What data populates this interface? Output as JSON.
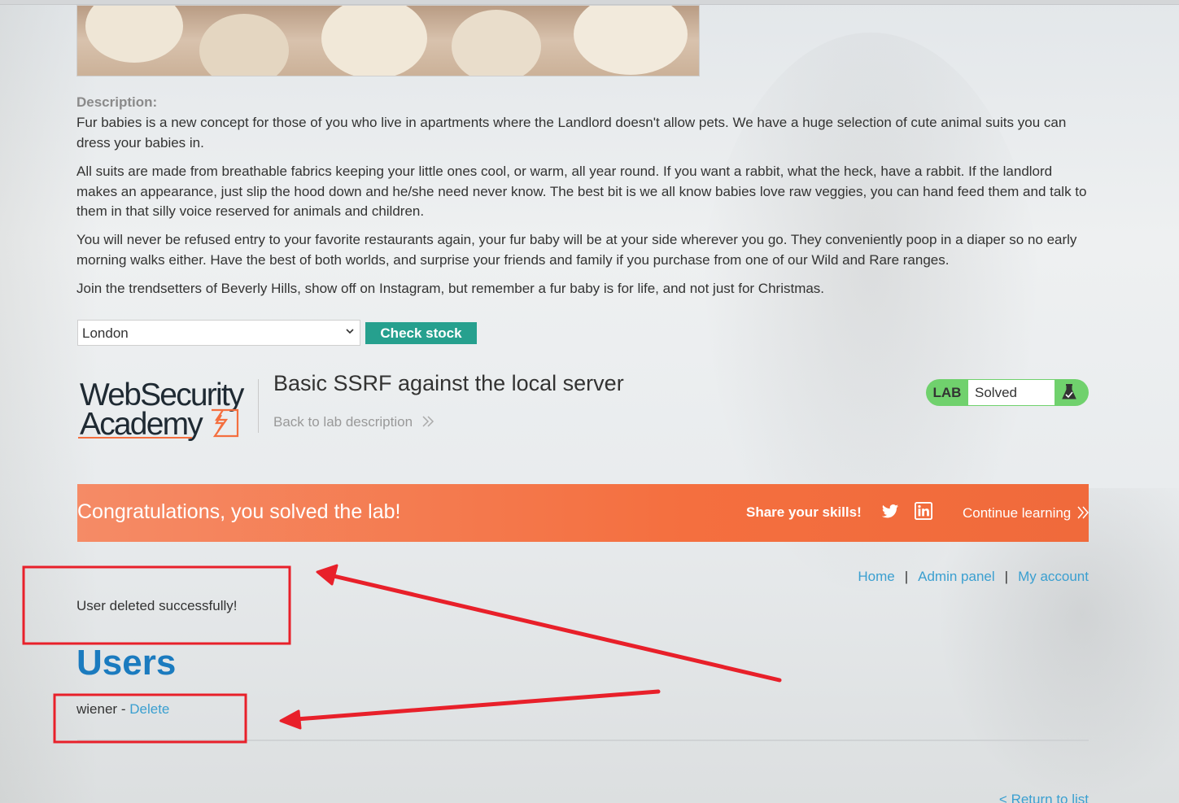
{
  "description": {
    "label": "Description:",
    "paragraphs": [
      "Fur babies is a new concept for those of you who live in apartments where the Landlord doesn't allow pets. We have a huge selection of cute animal suits you can dress your babies in.",
      "All suits are made from breathable fabrics keeping your little ones cool, or warm, all year round. If you want a rabbit, what the heck, have a rabbit. If the landlord makes an appearance, just slip the hood down and he/she need never know. The best bit is we all know babies love raw veggies, you can hand feed them and talk to them in that silly voice reserved for animals and children.",
      "You will never be refused entry to your favorite restaurants again, your fur baby will be at your side wherever you go. They conveniently poop in a diaper so no early morning walks either. Have the best of both worlds, and surprise your friends and family if you purchase from one of our Wild and Rare ranges.",
      "Join the trendsetters of Beverly Hills, show off on Instagram, but remember a fur baby is for life, and not just for Christmas."
    ]
  },
  "stock": {
    "selected_store": "London",
    "check_button": "Check stock"
  },
  "header": {
    "logo_line1": "WebSecurity",
    "logo_line2": "Academy",
    "lab_title": "Basic SSRF against the local server",
    "back_link": "Back to lab description",
    "lab_tag": "LAB",
    "lab_status": "Solved"
  },
  "banner": {
    "congrats": "Congratulations, you solved the lab!",
    "share": "Share your skills!",
    "continue": "Continue learning"
  },
  "nav": {
    "home": "Home",
    "admin": "Admin panel",
    "account": "My account",
    "separator": "|"
  },
  "admin": {
    "message": "User deleted successfully!",
    "heading": "Users",
    "users": [
      {
        "name": "wiener",
        "separator": "-",
        "action": "Delete"
      }
    ]
  },
  "footer": {
    "return_link": "< Return to list"
  },
  "colors": {
    "accent_teal": "#26a08e",
    "banner_orange": "#f46f3f",
    "link_blue": "#3a9fd0",
    "heading_blue": "#1b7bbf",
    "lab_green": "#70d16d",
    "annotation_red": "#e8202a"
  }
}
